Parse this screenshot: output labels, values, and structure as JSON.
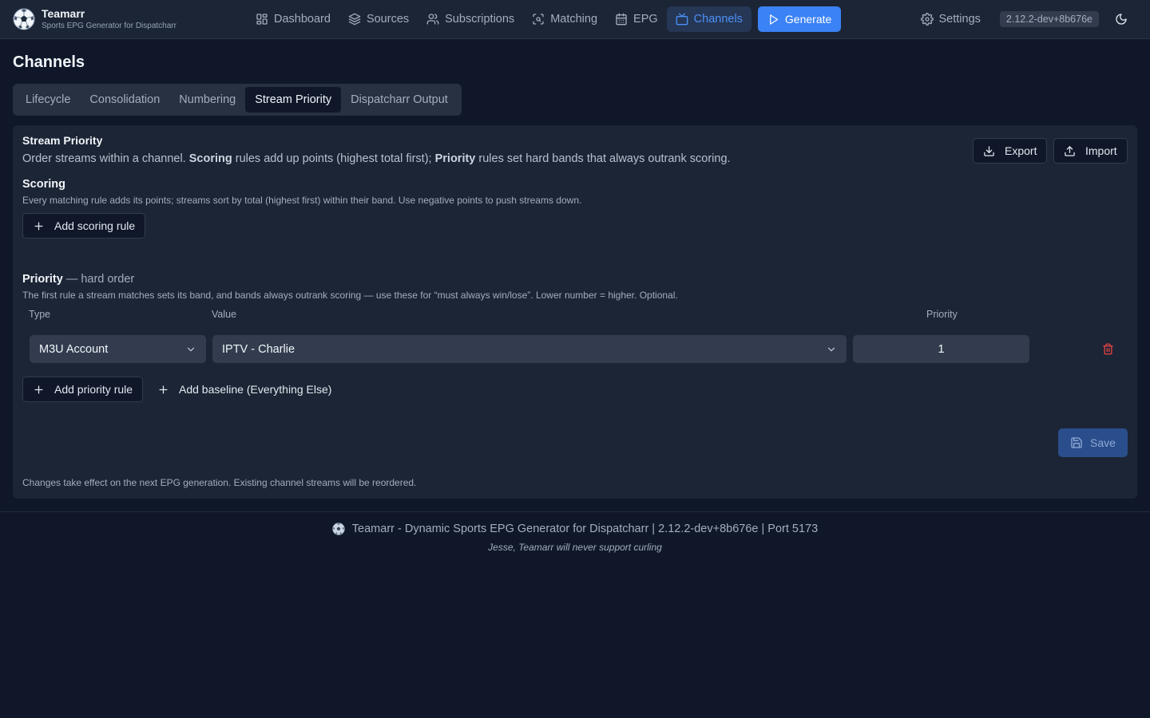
{
  "brand": {
    "title": "Teamarr",
    "subtitle": "Sports EPG Generator for Dispatcharr",
    "logo_icon": "soccer-ball-icon"
  },
  "nav": {
    "items": [
      {
        "label": "Dashboard",
        "icon": "dashboard-icon"
      },
      {
        "label": "Sources",
        "icon": "layers-icon"
      },
      {
        "label": "Subscriptions",
        "icon": "users-icon"
      },
      {
        "label": "Matching",
        "icon": "scan-icon"
      },
      {
        "label": "EPG",
        "icon": "calendar-icon"
      },
      {
        "label": "Channels",
        "icon": "tv-icon",
        "active": true
      }
    ],
    "generate_label": "Generate",
    "settings_label": "Settings",
    "version": "2.12.2-dev+8b676e"
  },
  "page": {
    "title": "Channels"
  },
  "tabs": [
    {
      "label": "Lifecycle"
    },
    {
      "label": "Consolidation"
    },
    {
      "label": "Numbering"
    },
    {
      "label": "Stream Priority",
      "active": true
    },
    {
      "label": "Dispatcharr Output"
    }
  ],
  "card": {
    "title": "Stream Priority",
    "desc_1": "Order streams within a channel. ",
    "desc_bold_1": "Scoring",
    "desc_2": " rules add up points (highest total first); ",
    "desc_bold_2": "Priority",
    "desc_3": " rules set hard bands that always outrank scoring.",
    "export_label": "Export",
    "import_label": "Import",
    "scoring": {
      "title": "Scoring",
      "hint": "Every matching rule adds its points; streams sort by total (highest first) within their band. Use negative points to push streams down.",
      "add_label": "Add scoring rule"
    },
    "priority": {
      "title": "Priority",
      "title_suffix": " — hard order",
      "hint": "The first rule a stream matches sets its band, and bands always outrank scoring — use these for “must always win/lose”. Lower number = higher. Optional.",
      "col_type": "Type",
      "col_value": "Value",
      "col_priority": "Priority",
      "rules": [
        {
          "type": "M3U Account",
          "value": "IPTV - Charlie",
          "priority": "1"
        }
      ],
      "add_label": "Add priority rule",
      "add_baseline_label": "Add baseline (Everything Else)"
    },
    "save_label": "Save",
    "footer_note": "Changes take effect on the next EPG generation. Existing channel streams will be reordered."
  },
  "footer": {
    "text": "Teamarr - Dynamic Sports EPG Generator for Dispatcharr | 2.12.2-dev+8b676e | Port 5173",
    "quote": "Jesse, Teamarr will never support curling"
  },
  "colors": {
    "background": "#0f1729",
    "surface": "#1c2535",
    "accent": "#3b82f6",
    "active_nav_text": "#4d90f7",
    "danger": "#ef4444"
  }
}
